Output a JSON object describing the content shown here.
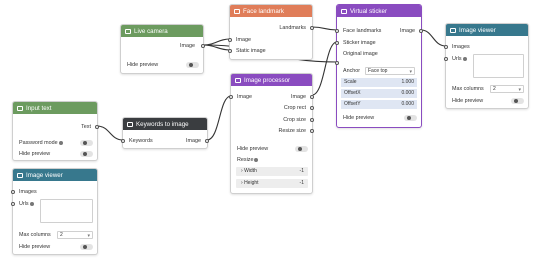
{
  "colors": {
    "green": "#6c9b5f",
    "orange": "#e07d59",
    "purple": "#8a4cc0",
    "dark": "#3a3d40",
    "teal": "#37788d",
    "wire": "#333333"
  },
  "nodes": {
    "live_camera": {
      "title": "Live camera",
      "icon": "camera-icon",
      "out_image": "Image",
      "hide_preview": "Hide preview"
    },
    "face_landmark": {
      "title": "Face landmark",
      "icon": "face-icon",
      "out_landmarks": "Landmarks",
      "in_image": "Image",
      "in_static_image": "Static image"
    },
    "virtual_sticker": {
      "title": "Virtual sticker",
      "icon": "sticker-icon",
      "in_face_landmarks": "Face landmarks",
      "out_image": "Image",
      "in_sticker_image": "Sticker image",
      "in_original_image": "Original image",
      "anchor_label": "Anchor",
      "anchor_value": "Face top",
      "params": [
        {
          "label": "Scale",
          "value": "1.000"
        },
        {
          "label": "OffsetX",
          "value": "0.000"
        },
        {
          "label": "OffsetY",
          "value": "0.000"
        }
      ],
      "hide_preview": "Hide preview"
    },
    "image_viewer_right": {
      "title": "Image viewer",
      "icon": "viewer-icon",
      "in_images": "Images",
      "in_urls": "Urls",
      "max_columns_label": "Max columns",
      "max_columns_value": "2",
      "hide_preview": "Hide preview"
    },
    "image_processor": {
      "title": "Image processor",
      "icon": "processor-icon",
      "in_image": "Image",
      "out_image": "Image",
      "out_crop_rect": "Crop rect",
      "out_crop_size": "Crop size",
      "out_resize_size": "Resize size",
      "hide_preview": "Hide preview",
      "resize_label": "Resize",
      "width_label": "Width",
      "width_value": "-1",
      "height_label": "Height",
      "height_value": "-1"
    },
    "input_text": {
      "title": "Input text",
      "icon": "text-icon",
      "out_text": "Text",
      "password_mode": "Password mode",
      "hide_preview": "Hide preview"
    },
    "keywords_to_image": {
      "title": "Keywords to image",
      "icon": "keywords-icon",
      "in_keywords": "Keywords",
      "out_image": "Image"
    },
    "image_viewer_left": {
      "title": "Image viewer",
      "icon": "viewer-icon",
      "in_images": "Images",
      "in_urls": "Urls",
      "max_columns_label": "Max columns",
      "max_columns_value": "2",
      "hide_preview": "Hide preview"
    }
  }
}
